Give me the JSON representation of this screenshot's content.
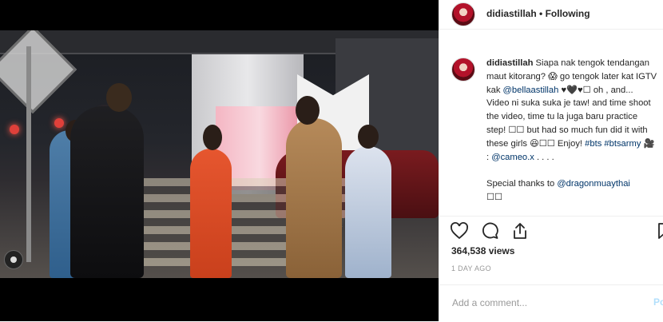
{
  "post": {
    "username": "didiastillah",
    "separator": "•",
    "follow_status": "Following"
  },
  "caption": {
    "username": "didiastillah",
    "text_1": "Siapa nak tengok tendangan maut kitorang? 😱 go tengok later kat IGTV kak",
    "mention_1": "@bellaastillah",
    "text_2": "♥🖤♥☐ oh , and... Video ni suka suka je taw! and time shoot the video, time tu la juga baru practice step! ☐☐ but had so much fun did it with these girls 😆☐☐ Enjoy!",
    "hashtag_1": "#bts",
    "hashtag_2": "#btsarmy",
    "text_3": "🎥 :",
    "mention_2": "@cameo.x",
    "text_4": ". . . .",
    "thanks_text": "Special thanks to",
    "mention_3": "@dragonmuaythai",
    "trail": "☐☐"
  },
  "actions": {
    "like_icon": "heart-icon",
    "comment_icon": "comment-icon",
    "share_icon": "share-icon",
    "save_icon": "bookmark-icon"
  },
  "stats": {
    "views": "364,538 views",
    "time_ago": "1 DAY AGO"
  },
  "comment_box": {
    "placeholder": "Add a comment...",
    "post_label": "Po"
  },
  "colors": {
    "link": "#003569",
    "text": "#262626",
    "muted": "#999999",
    "post_disabled": "#b2dffc"
  }
}
